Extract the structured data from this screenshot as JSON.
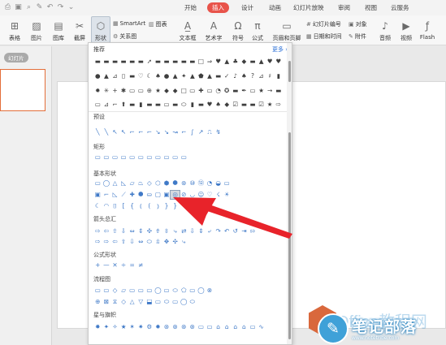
{
  "tabs": [
    "开始",
    "插入",
    "设计",
    "动画",
    "幻灯片放映",
    "审阅",
    "视图",
    "云服务"
  ],
  "active_tab": "插入",
  "ribbon": {
    "table": "表格",
    "picture": "图片",
    "gallery": "图库",
    "screenshot": "截屏",
    "shapes": "形状",
    "smartart": "SmartArt",
    "chart": "图表",
    "relation": "关系图",
    "textbox": "文本框",
    "art_text": "艺术字",
    "symbol": "符号",
    "formula": "公式",
    "header_footer": "页眉和页脚",
    "slide_number": "幻灯片编号",
    "date_time": "日期和时间",
    "object": "对象",
    "attachment": "附件",
    "audio": "音频",
    "video": "视频",
    "flash": "Flash"
  },
  "left_panel_tab": "幻灯片",
  "dropdown": {
    "recommended": "推荐",
    "more": "更多 »",
    "sections": [
      "预设",
      "矩形",
      "基本形状",
      "箭头总汇",
      "公式形状",
      "流程图",
      "星与旗帜"
    ],
    "rec_rows": [
      [
        "▬",
        "▬",
        "▬",
        "▬",
        "▬",
        "▬",
        "➚",
        "▬",
        "▬",
        "▬",
        "▬",
        "▬",
        "□",
        "⇒",
        "♥",
        "▲",
        "♣",
        "◆",
        "▬",
        "▲",
        "♥",
        "♥"
      ],
      [
        "●",
        "▲",
        "⊿",
        "▯",
        "▬",
        "♡",
        "☾",
        "♠",
        "●",
        "▲",
        "✦",
        "▲",
        "⬟",
        "▲",
        "▬",
        "✓",
        "♪",
        "♠",
        "?",
        "⊿",
        "♯",
        "▮"
      ],
      [
        "✹",
        "✳",
        "+",
        "✱",
        "▭",
        "▭",
        "⊕",
        "★",
        "◆",
        "◆",
        "□",
        "▭",
        "✚",
        "▭",
        "◔",
        "✪",
        "▬",
        "✒",
        "▭",
        "★",
        "→",
        "▬"
      ],
      [
        "▭",
        "⊿",
        "⌐",
        "⬆",
        "▬",
        "▮",
        "▬",
        "▬",
        "▭",
        "▬",
        "⬭",
        "▮",
        "▬",
        "♥",
        "♠",
        "◆",
        "☑",
        "▬",
        "▬",
        "☑",
        "★",
        "⇨"
      ]
    ],
    "preset_row": [
      "╲",
      "╲",
      "↖",
      "↖",
      "⌐",
      "⌐",
      "⌐",
      "↘",
      "↘",
      "↝",
      "⌐",
      "∫",
      "↗",
      "⎍",
      "↯"
    ],
    "rect_row": [
      "▭",
      "▭",
      "▭",
      "▭",
      "▭",
      "▭",
      "▭",
      "▭",
      "▭",
      "▭",
      "▭"
    ],
    "basic_rows": [
      [
        "▭",
        "◯",
        "△",
        "◺",
        "▱",
        "⏢",
        "◇",
        "⬡",
        "⬢",
        "⯃",
        "⊛",
        "⑩",
        "⑫",
        "◔",
        "◒",
        "▭"
      ],
      [
        "▣",
        "⌐",
        "◺",
        "⟋",
        "✚",
        "⯃",
        "⛀",
        "▢",
        "▣",
        "◎",
        "⊘",
        "◡",
        "☺",
        "♡",
        "☇",
        "☀"
      ],
      [
        "☾",
        "◠",
        "⌷",
        "[",
        "{",
        "⦅",
        "(",
        "⦆",
        "}",
        "}"
      ]
    ],
    "arrow_rows": [
      [
        "⇨",
        "⇦",
        "⇧",
        "⇩",
        "⇔",
        "⇕",
        "✣",
        "⇮",
        "⇳",
        "⤷",
        "⇄",
        "⇩",
        "⇕",
        "⤶",
        "↷",
        "↶",
        "↺",
        "⇥",
        "⇰"
      ],
      [
        "⇨",
        "⇨",
        "⇦",
        "⇧",
        "⇩",
        "⇔",
        "⬭",
        "⇫",
        "✥",
        "✣",
        "⤷"
      ]
    ],
    "formula_row": [
      "+",
      "—",
      "✕",
      "÷",
      "=",
      "≠"
    ],
    "flow_rows": [
      [
        "▭",
        "▭",
        "◇",
        "▱",
        "▭",
        "▭",
        "▭",
        "◯",
        "▭",
        "⬭",
        "⬠",
        "▭",
        "◯",
        "⊗"
      ],
      [
        "⊕",
        "⊠",
        "⧖",
        "◇",
        "△",
        "▽",
        "⬓",
        "▭",
        "⬭",
        "▭",
        "◯",
        "⬭"
      ]
    ],
    "star_rows": [
      [
        "✸",
        "✦",
        "✧",
        "★",
        "✶",
        "✷",
        "⚙",
        "✹",
        "⊛",
        "⊛",
        "⊛",
        "⊛",
        "▭",
        "▭",
        "⌂",
        "⌂",
        "⌂",
        "⌂",
        "▭",
        "∿"
      ]
    ]
  },
  "watermark": {
    "text": "Office教程网",
    "title": "笔记部落",
    "url": "www.notetribe.com"
  },
  "colors": {
    "accent": "#e8534a",
    "arrow": "#e8232a",
    "shape_icon": "#3f79c7",
    "highlight": "#d3d8df"
  }
}
